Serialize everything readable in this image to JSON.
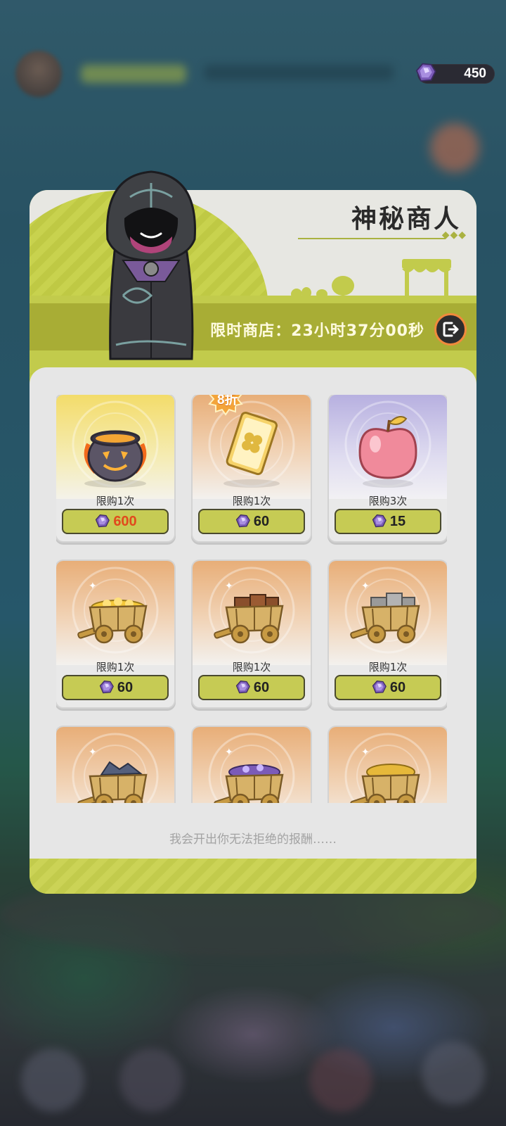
{
  "currency": {
    "gem_icon": "purple-crystal-icon",
    "amount": "450"
  },
  "shop": {
    "title": "神秘商人",
    "timer": "限时商店：23小时37分00秒",
    "footer": "我会开出你无法拒绝的报酬……"
  },
  "items": [
    {
      "name": "pumpkin-cauldron",
      "limit": "限购1次",
      "price": "600",
      "price_color": "#e14a1d",
      "badge": ""
    },
    {
      "name": "clover-card",
      "limit": "限购1次",
      "price": "60",
      "price_color": "#222222",
      "badge": "8折"
    },
    {
      "name": "pink-apple",
      "limit": "限购3次",
      "price": "15",
      "price_color": "#222222",
      "badge": ""
    },
    {
      "name": "gold-coin-cart",
      "limit": "限购1次",
      "price": "60",
      "price_color": "#222222",
      "badge": ""
    },
    {
      "name": "wood-plank-cart",
      "limit": "限购1次",
      "price": "60",
      "price_color": "#222222",
      "badge": ""
    },
    {
      "name": "stone-brick-cart",
      "limit": "限购1次",
      "price": "60",
      "price_color": "#222222",
      "badge": ""
    },
    {
      "name": "blue-ore-cart",
      "limit": "",
      "price": "",
      "price_color": "#222222",
      "badge": ""
    },
    {
      "name": "purple-crystal-cart",
      "limit": "",
      "price": "",
      "price_color": "#222222",
      "badge": ""
    },
    {
      "name": "gold-nugget-cart",
      "limit": "",
      "price": "",
      "price_color": "#222222",
      "badge": ""
    }
  ],
  "colors": {
    "accent": "#c2cb4c",
    "band": "#a8ad35",
    "price_button": "#c6cb54",
    "badge": "#f3a43a"
  }
}
